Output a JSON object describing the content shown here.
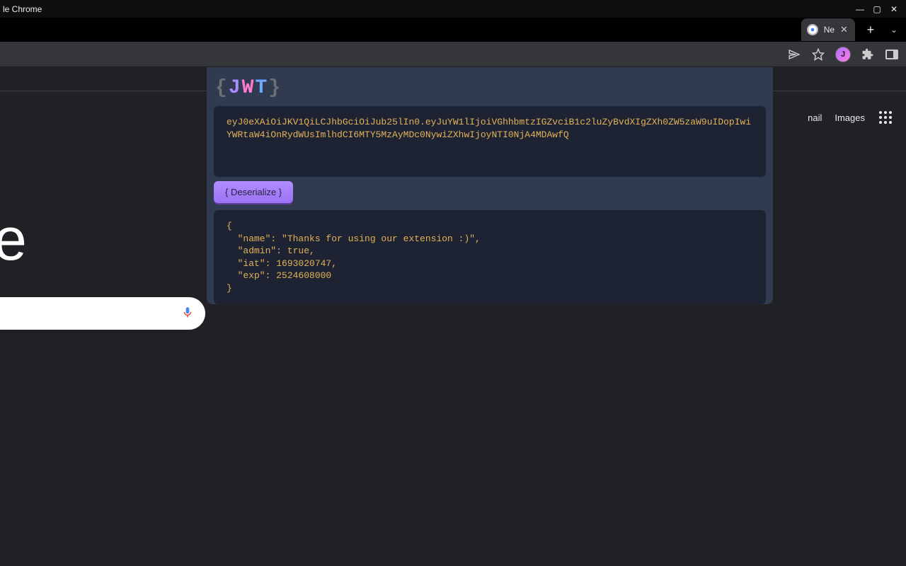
{
  "os": {
    "title": "le Chrome"
  },
  "browser": {
    "tab_label": "Ne",
    "avatar_initial": "J"
  },
  "google": {
    "link_gmail": "nail",
    "link_images": "Images",
    "logo": "ogle"
  },
  "ext": {
    "token": "eyJ0eXAiOiJKV1QiLCJhbGciOiJub25lIn0.eyJuYW1lIjoiVGhhbmtzIGZvciB1c2luZyBvdXIgZXh0ZW5zaW9uIDopIwiYWRtaW4iOnRydWUsImlhdCI6MTY5MzAyMDc0NywiZXhwIjoyNTI0NjA4MDAwfQ",
    "btn_deserialize": "{ Deserialize }",
    "output": "{\n  \"name\": \"Thanks for using our extension :)\",\n  \"admin\": true,\n  \"iat\": 1693020747,\n  \"exp\": 2524608000\n}"
  }
}
